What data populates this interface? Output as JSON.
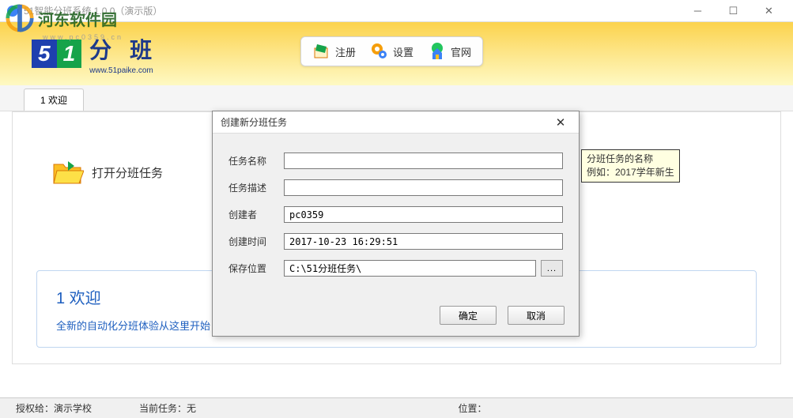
{
  "window": {
    "title": "51智能分班系统 1.0.0（演示版）",
    "watermark_text": "河东软件园",
    "watermark_sub": "www.pc0359.cn"
  },
  "logo": {
    "text": "分 班",
    "url": "www.51paike.com"
  },
  "toolbar": {
    "register": "注册",
    "settings": "设置",
    "website": "官网"
  },
  "tabs": {
    "welcome": "1 欢迎"
  },
  "main": {
    "open_task": "打开分班任务"
  },
  "welcome": {
    "title": "1  欢迎",
    "text": "全新的自动化分班体验从这里开始！"
  },
  "status": {
    "licensed_to_label": "授权给：",
    "licensed_to_value": "演示学校",
    "current_task_label": "当前任务：",
    "current_task_value": "无",
    "location_label": "位置："
  },
  "dialog": {
    "title": "创建新分班任务",
    "labels": {
      "name": "任务名称",
      "description": "任务描述",
      "creator": "创建者",
      "create_time": "创建时间",
      "save_location": "保存位置"
    },
    "values": {
      "name": "",
      "description": "",
      "creator": "pc0359",
      "create_time": "2017-10-23 16:29:51",
      "save_location": "C:\\51分班任务\\"
    },
    "browse": "...",
    "ok": "确定",
    "cancel": "取消"
  },
  "tooltip": {
    "line1": "分班任务的名称",
    "line2": "例如：2017学年新生"
  }
}
